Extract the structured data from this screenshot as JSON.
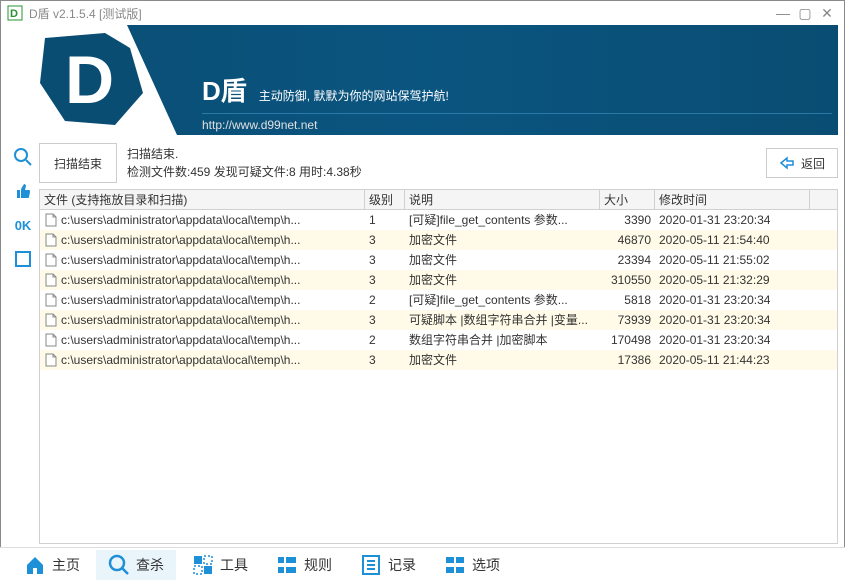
{
  "window": {
    "title": "D盾 v2.1.5.4 [测试版]"
  },
  "banner": {
    "brand_name": "D盾",
    "slogan": "主动防御, 默默为你的网站保驾护航!",
    "url": "http://www.d99net.net"
  },
  "status": {
    "scan_result_btn": "扫描结束",
    "line1": "扫描结束.",
    "line2": "检测文件数:459 发现可疑文件:8 用时:4.38秒",
    "back_btn": "返回"
  },
  "sidebar_labels": {
    "ok": "0K"
  },
  "table": {
    "headers": {
      "file": "文件 (支持拖放目录和扫描)",
      "level": "级别",
      "desc": "说明",
      "size": "大小",
      "time": "修改时间"
    },
    "rows": [
      {
        "file": "c:\\users\\administrator\\appdata\\local\\temp\\h...",
        "level": "1",
        "desc": "[可疑]file_get_contents 参数...",
        "size": "3390",
        "time": "2020-01-31 23:20:34"
      },
      {
        "file": "c:\\users\\administrator\\appdata\\local\\temp\\h...",
        "level": "3",
        "desc": "加密文件",
        "size": "46870",
        "time": "2020-05-11 21:54:40"
      },
      {
        "file": "c:\\users\\administrator\\appdata\\local\\temp\\h...",
        "level": "3",
        "desc": "加密文件",
        "size": "23394",
        "time": "2020-05-11 21:55:02"
      },
      {
        "file": "c:\\users\\administrator\\appdata\\local\\temp\\h...",
        "level": "3",
        "desc": "加密文件",
        "size": "310550",
        "time": "2020-05-11 21:32:29"
      },
      {
        "file": "c:\\users\\administrator\\appdata\\local\\temp\\h...",
        "level": "2",
        "desc": "[可疑]file_get_contents 参数...",
        "size": "5818",
        "time": "2020-01-31 23:20:34"
      },
      {
        "file": "c:\\users\\administrator\\appdata\\local\\temp\\h...",
        "level": "3",
        "desc": "可疑脚本 |数组字符串合并 |变量...",
        "size": "73939",
        "time": "2020-01-31 23:20:34"
      },
      {
        "file": "c:\\users\\administrator\\appdata\\local\\temp\\h...",
        "level": "2",
        "desc": "数组字符串合并 |加密脚本",
        "size": "170498",
        "time": "2020-01-31 23:20:34"
      },
      {
        "file": "c:\\users\\administrator\\appdata\\local\\temp\\h...",
        "level": "3",
        "desc": "加密文件",
        "size": "17386",
        "time": "2020-05-11 21:44:23"
      }
    ]
  },
  "tabs": {
    "home": "主页",
    "scan": "查杀",
    "tools": "工具",
    "rules": "规则",
    "logs": "记录",
    "options": "选项"
  }
}
